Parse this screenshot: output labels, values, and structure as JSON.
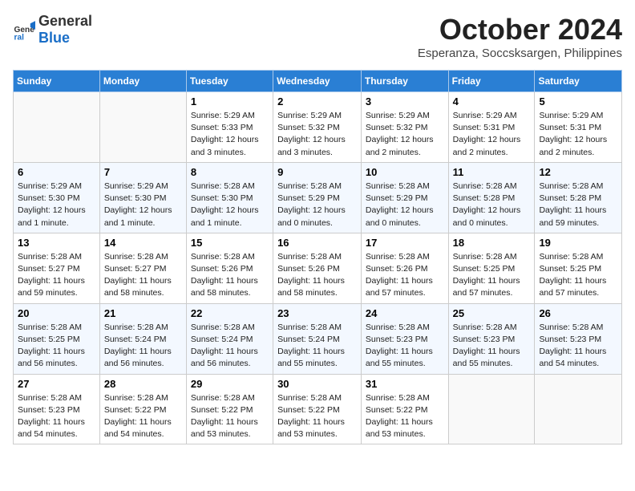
{
  "logo": {
    "general": "General",
    "blue": "Blue"
  },
  "title": {
    "month_year": "October 2024",
    "location": "Esperanza, Soccsksargen, Philippines"
  },
  "weekdays": [
    "Sunday",
    "Monday",
    "Tuesday",
    "Wednesday",
    "Thursday",
    "Friday",
    "Saturday"
  ],
  "weeks": [
    [
      {
        "day": "",
        "info": ""
      },
      {
        "day": "",
        "info": ""
      },
      {
        "day": "1",
        "info": "Sunrise: 5:29 AM\nSunset: 5:33 PM\nDaylight: 12 hours and 3 minutes."
      },
      {
        "day": "2",
        "info": "Sunrise: 5:29 AM\nSunset: 5:32 PM\nDaylight: 12 hours and 3 minutes."
      },
      {
        "day": "3",
        "info": "Sunrise: 5:29 AM\nSunset: 5:32 PM\nDaylight: 12 hours and 2 minutes."
      },
      {
        "day": "4",
        "info": "Sunrise: 5:29 AM\nSunset: 5:31 PM\nDaylight: 12 hours and 2 minutes."
      },
      {
        "day": "5",
        "info": "Sunrise: 5:29 AM\nSunset: 5:31 PM\nDaylight: 12 hours and 2 minutes."
      }
    ],
    [
      {
        "day": "6",
        "info": "Sunrise: 5:29 AM\nSunset: 5:30 PM\nDaylight: 12 hours and 1 minute."
      },
      {
        "day": "7",
        "info": "Sunrise: 5:29 AM\nSunset: 5:30 PM\nDaylight: 12 hours and 1 minute."
      },
      {
        "day": "8",
        "info": "Sunrise: 5:28 AM\nSunset: 5:30 PM\nDaylight: 12 hours and 1 minute."
      },
      {
        "day": "9",
        "info": "Sunrise: 5:28 AM\nSunset: 5:29 PM\nDaylight: 12 hours and 0 minutes."
      },
      {
        "day": "10",
        "info": "Sunrise: 5:28 AM\nSunset: 5:29 PM\nDaylight: 12 hours and 0 minutes."
      },
      {
        "day": "11",
        "info": "Sunrise: 5:28 AM\nSunset: 5:28 PM\nDaylight: 12 hours and 0 minutes."
      },
      {
        "day": "12",
        "info": "Sunrise: 5:28 AM\nSunset: 5:28 PM\nDaylight: 11 hours and 59 minutes."
      }
    ],
    [
      {
        "day": "13",
        "info": "Sunrise: 5:28 AM\nSunset: 5:27 PM\nDaylight: 11 hours and 59 minutes."
      },
      {
        "day": "14",
        "info": "Sunrise: 5:28 AM\nSunset: 5:27 PM\nDaylight: 11 hours and 58 minutes."
      },
      {
        "day": "15",
        "info": "Sunrise: 5:28 AM\nSunset: 5:26 PM\nDaylight: 11 hours and 58 minutes."
      },
      {
        "day": "16",
        "info": "Sunrise: 5:28 AM\nSunset: 5:26 PM\nDaylight: 11 hours and 58 minutes."
      },
      {
        "day": "17",
        "info": "Sunrise: 5:28 AM\nSunset: 5:26 PM\nDaylight: 11 hours and 57 minutes."
      },
      {
        "day": "18",
        "info": "Sunrise: 5:28 AM\nSunset: 5:25 PM\nDaylight: 11 hours and 57 minutes."
      },
      {
        "day": "19",
        "info": "Sunrise: 5:28 AM\nSunset: 5:25 PM\nDaylight: 11 hours and 57 minutes."
      }
    ],
    [
      {
        "day": "20",
        "info": "Sunrise: 5:28 AM\nSunset: 5:25 PM\nDaylight: 11 hours and 56 minutes."
      },
      {
        "day": "21",
        "info": "Sunrise: 5:28 AM\nSunset: 5:24 PM\nDaylight: 11 hours and 56 minutes."
      },
      {
        "day": "22",
        "info": "Sunrise: 5:28 AM\nSunset: 5:24 PM\nDaylight: 11 hours and 56 minutes."
      },
      {
        "day": "23",
        "info": "Sunrise: 5:28 AM\nSunset: 5:24 PM\nDaylight: 11 hours and 55 minutes."
      },
      {
        "day": "24",
        "info": "Sunrise: 5:28 AM\nSunset: 5:23 PM\nDaylight: 11 hours and 55 minutes."
      },
      {
        "day": "25",
        "info": "Sunrise: 5:28 AM\nSunset: 5:23 PM\nDaylight: 11 hours and 55 minutes."
      },
      {
        "day": "26",
        "info": "Sunrise: 5:28 AM\nSunset: 5:23 PM\nDaylight: 11 hours and 54 minutes."
      }
    ],
    [
      {
        "day": "27",
        "info": "Sunrise: 5:28 AM\nSunset: 5:23 PM\nDaylight: 11 hours and 54 minutes."
      },
      {
        "day": "28",
        "info": "Sunrise: 5:28 AM\nSunset: 5:22 PM\nDaylight: 11 hours and 54 minutes."
      },
      {
        "day": "29",
        "info": "Sunrise: 5:28 AM\nSunset: 5:22 PM\nDaylight: 11 hours and 53 minutes."
      },
      {
        "day": "30",
        "info": "Sunrise: 5:28 AM\nSunset: 5:22 PM\nDaylight: 11 hours and 53 minutes."
      },
      {
        "day": "31",
        "info": "Sunrise: 5:28 AM\nSunset: 5:22 PM\nDaylight: 11 hours and 53 minutes."
      },
      {
        "day": "",
        "info": ""
      },
      {
        "day": "",
        "info": ""
      }
    ]
  ]
}
